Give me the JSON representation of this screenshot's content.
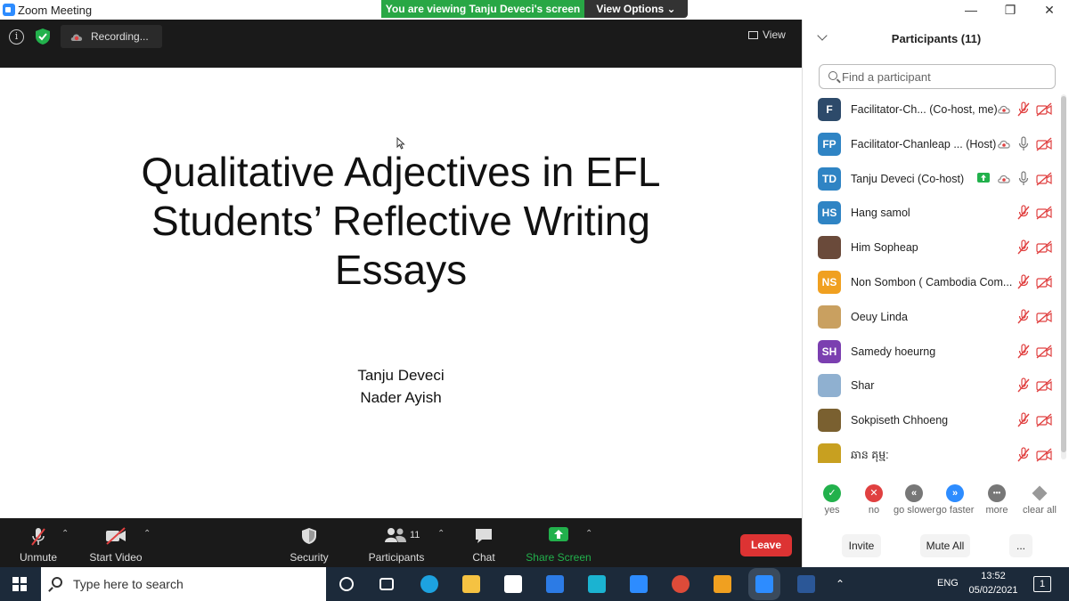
{
  "window": {
    "title": "Zoom Meeting",
    "minimize": "—",
    "restore": "❐",
    "close": "✕"
  },
  "share_bar": {
    "message": "You are viewing Tanju Deveci's screen",
    "view_options": "View Options ⌄"
  },
  "meeting_top": {
    "info": "i",
    "recording": "Recording...",
    "view": "View"
  },
  "slide": {
    "title_lines": [
      "Qualitative Adjectives in EFL",
      "Students’ Reflective Writing",
      "Essays"
    ],
    "authors": [
      "Tanju Deveci",
      "Nader Ayish"
    ]
  },
  "toolbar": {
    "unmute": "Unmute",
    "start_video": "Start Video",
    "security": "Security",
    "participants": "Participants",
    "participants_count": "11",
    "chat": "Chat",
    "share_screen": "Share Screen",
    "leave": "Leave",
    "caret": "⌃",
    "colors": {
      "share_green": "#22b14c",
      "leave_red": "#d33333"
    }
  },
  "panel": {
    "title": "Participants (11)",
    "search_placeholder": "Find a participant",
    "participants": [
      {
        "initials": "F",
        "name": "Facilitator-Ch...  (Co-host, me)",
        "avatar_color": "#2d4a6a",
        "mic_muted": true,
        "cam_off": true,
        "recording": true,
        "sharing": false
      },
      {
        "initials": "FP",
        "name": "Facilitator-Chanleap ...  (Host)",
        "avatar_color": "#2f84c4",
        "mic_muted": false,
        "cam_off": true,
        "recording": true,
        "sharing": false
      },
      {
        "initials": "TD",
        "name": "Tanju Deveci  (Co-host)",
        "avatar_color": "#2f84c4",
        "mic_muted": false,
        "cam_off": true,
        "recording": true,
        "sharing": true
      },
      {
        "initials": "HS",
        "name": "Hang samol",
        "avatar_color": "#2f84c4",
        "mic_muted": true,
        "cam_off": true,
        "recording": false,
        "sharing": false
      },
      {
        "initials": "",
        "name": "Him Sopheap",
        "avatar_color": "#6a4a3a",
        "mic_muted": true,
        "cam_off": true,
        "recording": false,
        "sharing": false
      },
      {
        "initials": "NS",
        "name": "Non Sombon ( Cambodia Com...",
        "avatar_color": "#f0a020",
        "mic_muted": true,
        "cam_off": true,
        "recording": false,
        "sharing": false
      },
      {
        "initials": "",
        "name": "Oeuy Linda",
        "avatar_color": "#c9a060",
        "mic_muted": true,
        "cam_off": true,
        "recording": false,
        "sharing": false
      },
      {
        "initials": "SH",
        "name": "Samedy hoeurng",
        "avatar_color": "#7b3fb0",
        "mic_muted": true,
        "cam_off": true,
        "recording": false,
        "sharing": false
      },
      {
        "initials": "",
        "name": "Shar",
        "avatar_color": "#8fb0d0",
        "mic_muted": true,
        "cam_off": true,
        "recording": false,
        "sharing": false
      },
      {
        "initials": "",
        "name": "Sokpiseth Chhoeng",
        "avatar_color": "#7a6030",
        "mic_muted": true,
        "cam_off": true,
        "recording": false,
        "sharing": false
      },
      {
        "initials": "",
        "name": "ឆាន គុម្ម:",
        "avatar_color": "#c8a020",
        "mic_muted": true,
        "cam_off": true,
        "recording": false,
        "sharing": false
      }
    ],
    "reactions": [
      {
        "label": "yes",
        "symbol": "✓",
        "color": "#22b14c"
      },
      {
        "label": "no",
        "symbol": "✕",
        "color": "#e04040"
      },
      {
        "label": "go slower",
        "symbol": "«",
        "color": "#777777"
      },
      {
        "label": "go faster",
        "symbol": "»",
        "color": "#2d8cff"
      },
      {
        "label": "more",
        "symbol": "•••",
        "color": "#777777"
      },
      {
        "label": "clear all",
        "symbol": "",
        "color": "#999999"
      }
    ],
    "invite": "Invite",
    "mute_all": "Mute All",
    "more": "..."
  },
  "taskbar": {
    "search_placeholder": "Type here to search",
    "language": "ENG",
    "time": "13:52",
    "date": "05/02/2021",
    "notifications": "1"
  }
}
